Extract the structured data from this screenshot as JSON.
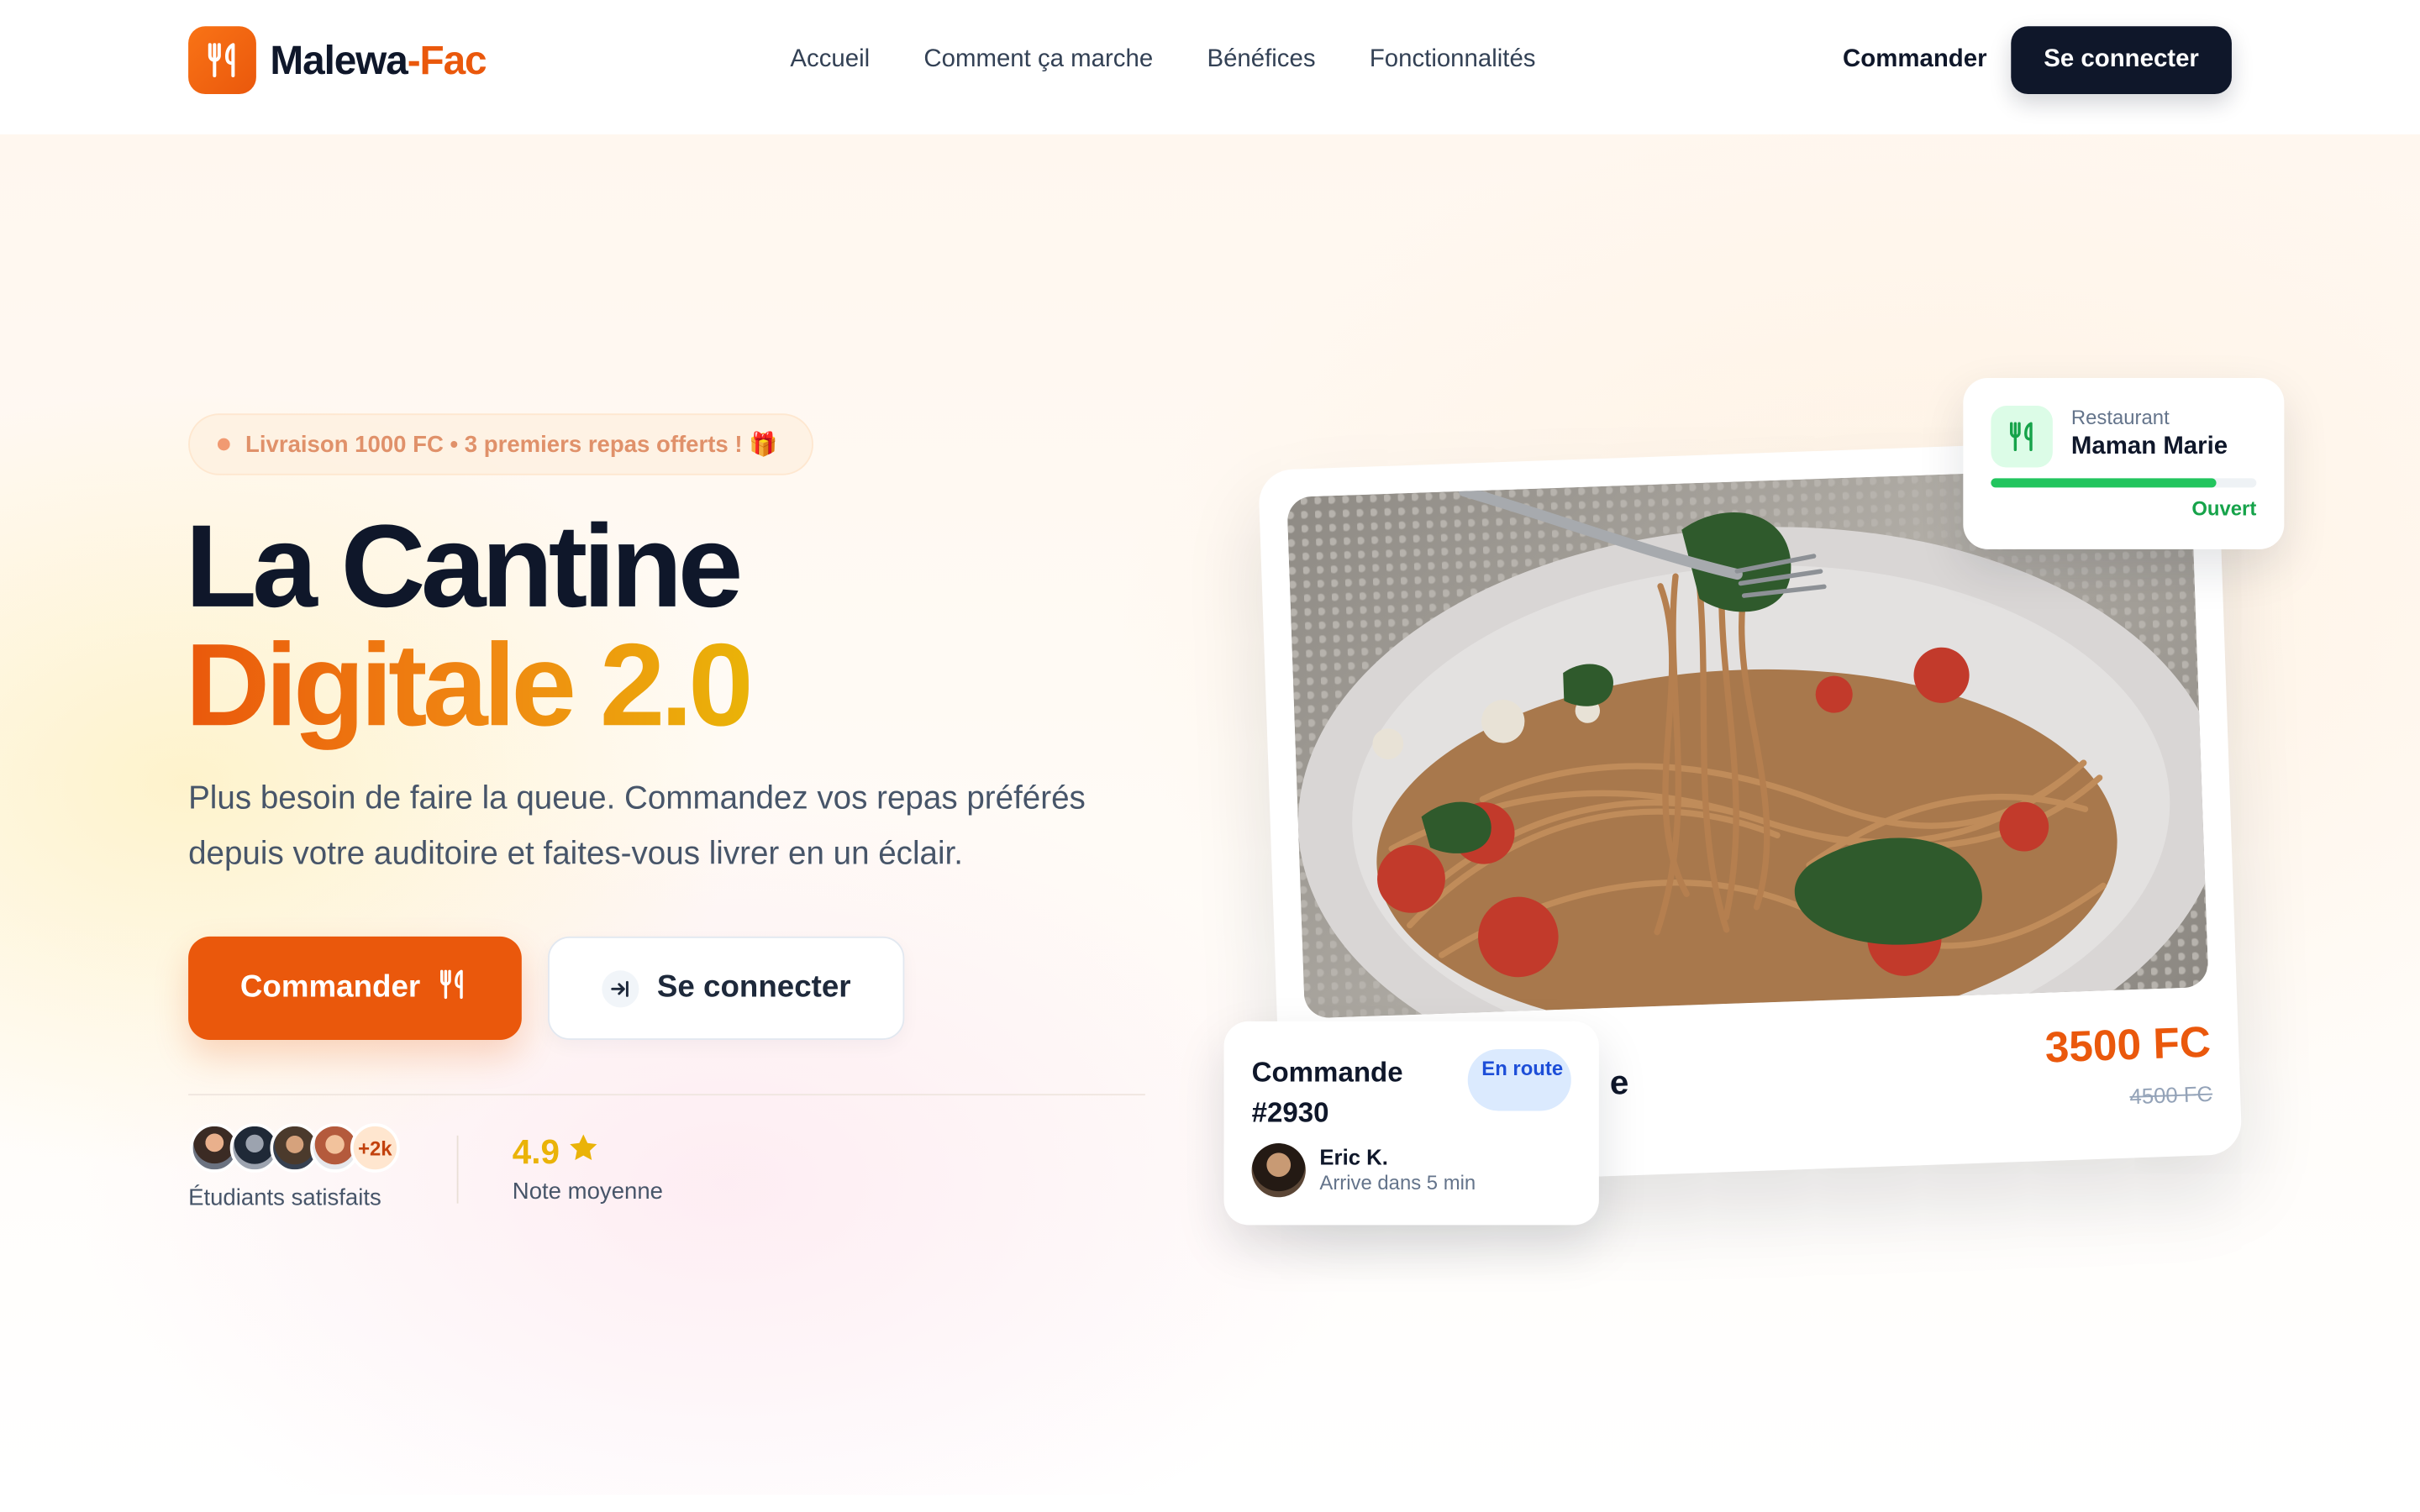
{
  "nav": {
    "brand_part1": "Malewa",
    "brand_part2": "-Fac",
    "links": [
      "Accueil",
      "Comment ça marche",
      "Bénéfices",
      "Fonctionnalités"
    ],
    "order_label": "Commander",
    "login_label": "Se connecter"
  },
  "hero": {
    "badge": "Livraison 1000 FC • 3 premiers repas offerts ! 🎁",
    "title_line1": "La Cantine",
    "title_line2": "Digitale 2.0",
    "lead": "Plus besoin de faire la queue. Commandez vos repas préférés depuis votre auditoire et faites-vous livrer en un éclair.",
    "cta_order": "Commander",
    "cta_login": "Se connecter",
    "stats": {
      "avatars_more": "+2k",
      "students_label": "Étudiants satisfaits",
      "rating_value": "4.9",
      "rating_label": "Note moyenne"
    }
  },
  "showcase": {
    "dish_name_fragment": "e",
    "price": "3500 FC",
    "old_price": "4500 FC",
    "restaurant": {
      "label": "Restaurant",
      "name": "Maman Marie",
      "status": "Ouvert",
      "progress": 0.85
    },
    "order": {
      "title": "Commande #2930",
      "status": "En route",
      "courier": "Eric K.",
      "eta": "Arrive dans 5 min"
    }
  },
  "colors": {
    "accent": "#ea580c",
    "dark": "#0f172a",
    "gold": "#eab308",
    "success": "#16a34a"
  }
}
